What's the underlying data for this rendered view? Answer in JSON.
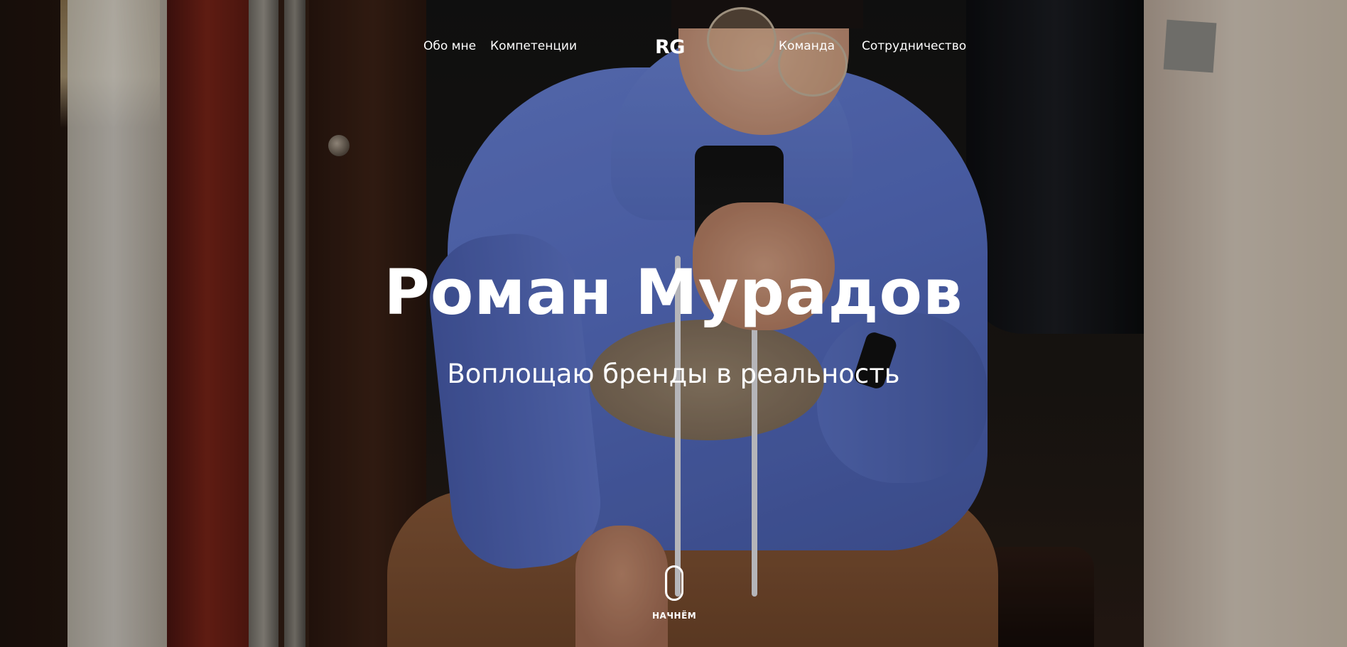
{
  "nav": {
    "logo": "RG",
    "links": [
      {
        "label": "Обо мне"
      },
      {
        "label": "Компетенции"
      },
      {
        "label": "Команда"
      },
      {
        "label": "Сотрудничество"
      }
    ]
  },
  "hero": {
    "title": "Роман Мурадов",
    "subtitle": "Воплощаю бренды в реальность",
    "background": "photo-mirror-selfie"
  },
  "scroll_cue": {
    "icon": "mouse-scroll-icon",
    "label": "НАЧНЁМ"
  },
  "colors": {
    "text": "#ffffff",
    "hoodie": "#5b74cc"
  }
}
